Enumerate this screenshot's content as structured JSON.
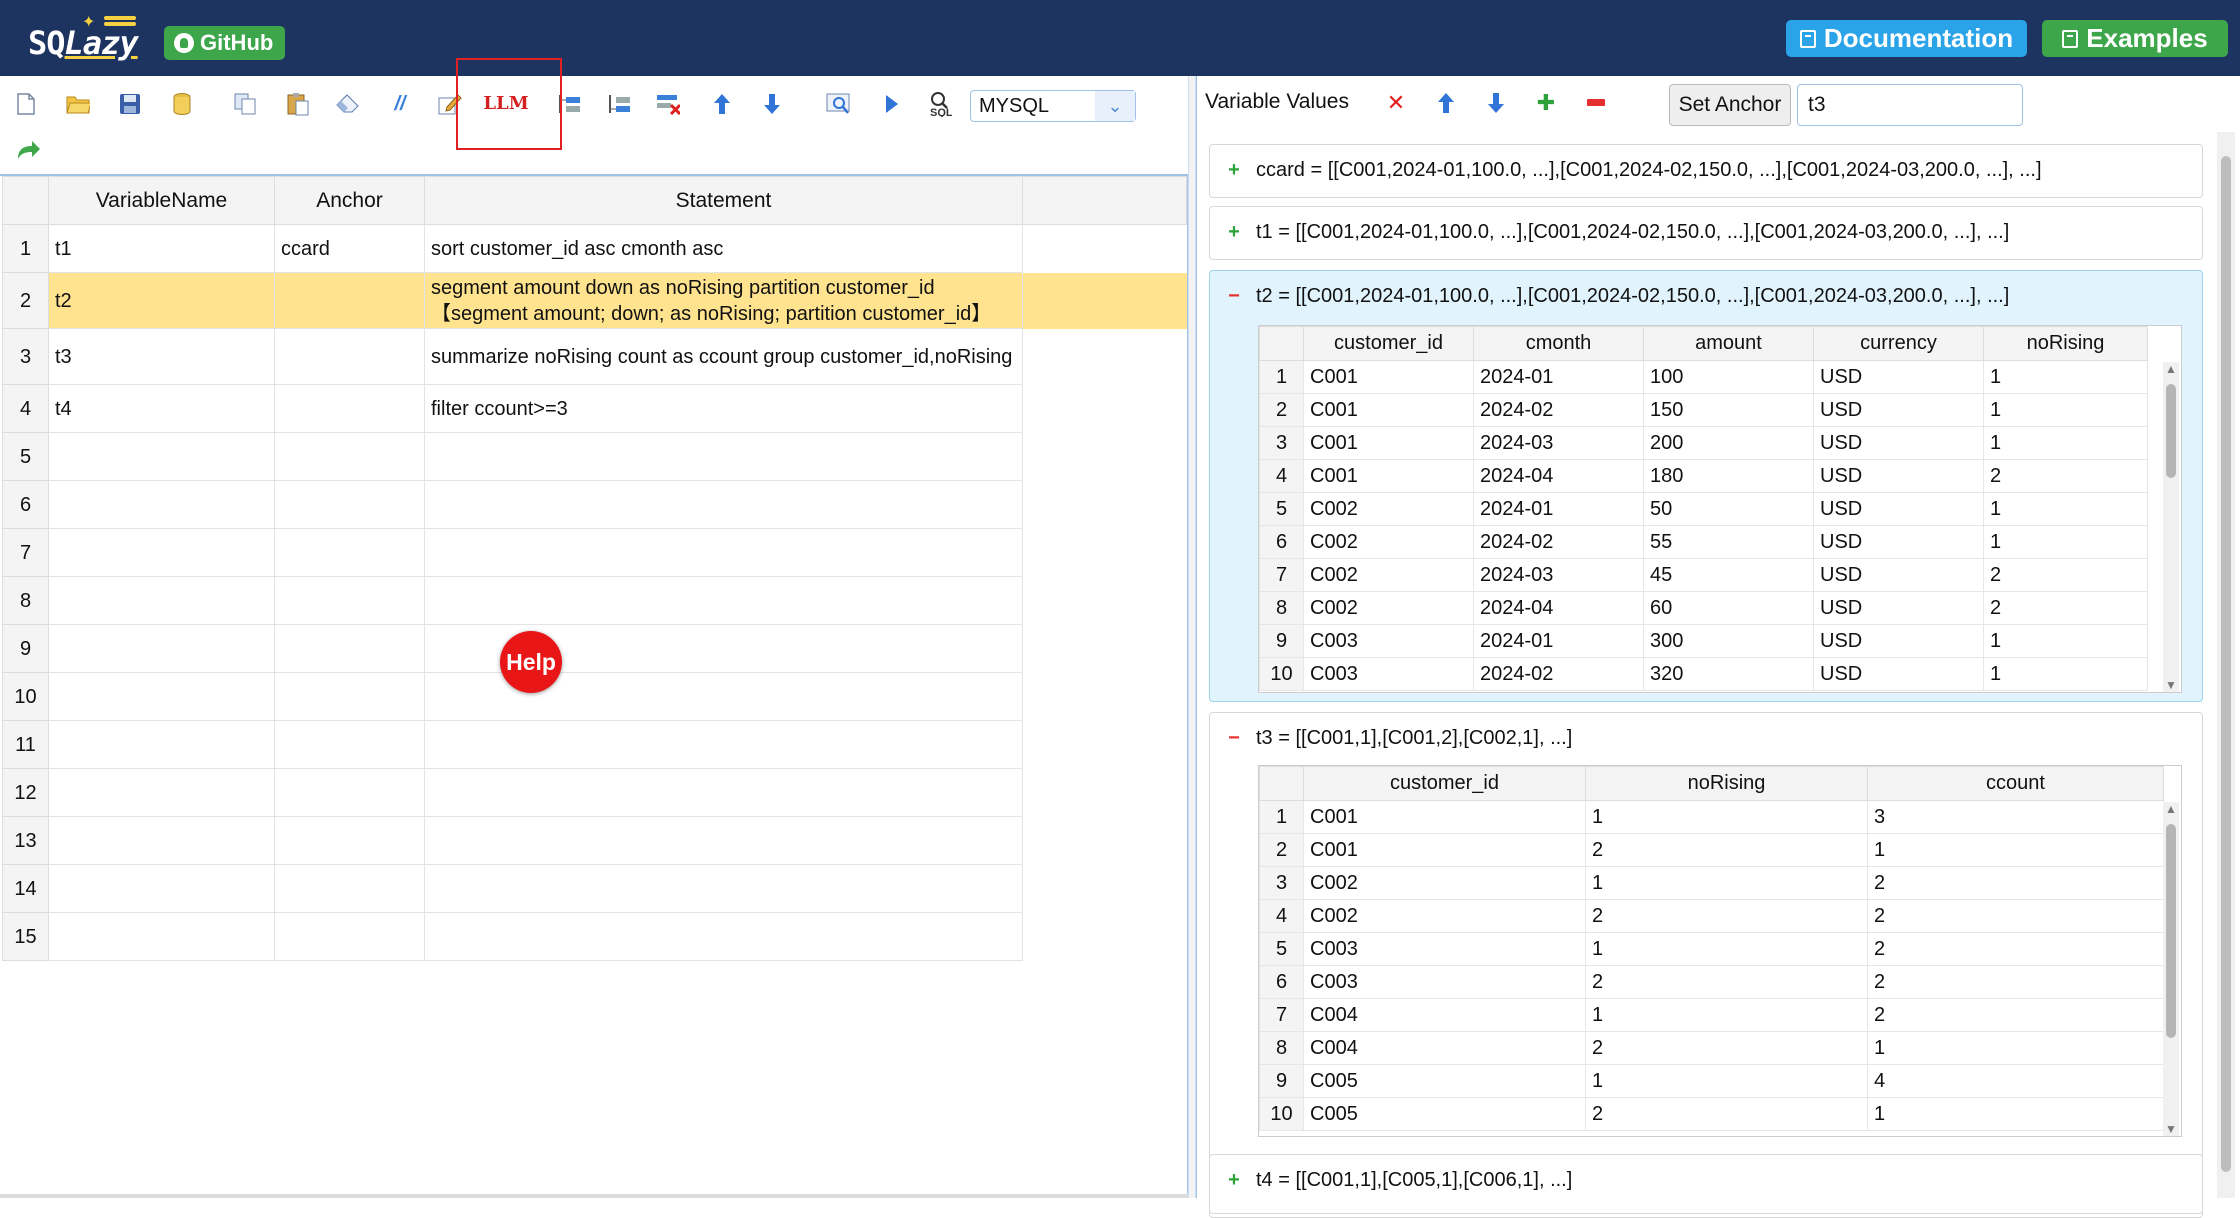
{
  "header": {
    "logo_text_a": "SQ",
    "logo_text_b": "Lazy",
    "github_label": "GitHub",
    "documentation_label": "Documentation",
    "examples_label": "Examples"
  },
  "toolbar": {
    "llm_label": "LLM",
    "db_select_value": "MYSQL",
    "icons": [
      "new-file-icon",
      "open-folder-icon",
      "save-icon",
      "database-icon",
      "copy-icon",
      "paste-icon",
      "eraser-icon",
      "comment-icon",
      "edit-icon",
      "llm-icon",
      "insert-row-above-icon",
      "insert-row-below-icon",
      "delete-row-icon",
      "move-up-icon",
      "move-down-icon",
      "preview-icon",
      "run-icon",
      "sql-icon",
      "redo-icon"
    ]
  },
  "grid": {
    "columns": [
      "VariableName",
      "Anchor",
      "Statement"
    ],
    "rows": [
      {
        "num": "1",
        "name": "t1",
        "anchor": "ccard",
        "statement": "sort customer_id asc cmonth asc"
      },
      {
        "num": "2",
        "name": "t2",
        "anchor": "",
        "statement": "segment amount down as noRising partition customer_id 【segment amount; down; as noRising; partition customer_id】"
      },
      {
        "num": "3",
        "name": "t3",
        "anchor": "",
        "statement": "summarize noRising count as ccount group customer_id,noRising"
      },
      {
        "num": "4",
        "name": "t4",
        "anchor": "",
        "statement": "filter ccount>=3"
      },
      {
        "num": "5",
        "name": "",
        "anchor": "",
        "statement": ""
      },
      {
        "num": "6",
        "name": "",
        "anchor": "",
        "statement": ""
      },
      {
        "num": "7",
        "name": "",
        "anchor": "",
        "statement": ""
      },
      {
        "num": "8",
        "name": "",
        "anchor": "",
        "statement": ""
      },
      {
        "num": "9",
        "name": "",
        "anchor": "",
        "statement": ""
      },
      {
        "num": "10",
        "name": "",
        "anchor": "",
        "statement": ""
      },
      {
        "num": "11",
        "name": "",
        "anchor": "",
        "statement": ""
      },
      {
        "num": "12",
        "name": "",
        "anchor": "",
        "statement": ""
      },
      {
        "num": "13",
        "name": "",
        "anchor": "",
        "statement": ""
      },
      {
        "num": "14",
        "name": "",
        "anchor": "",
        "statement": ""
      },
      {
        "num": "15",
        "name": "",
        "anchor": "",
        "statement": ""
      }
    ],
    "selected_row": 2
  },
  "help_label": "Help",
  "right": {
    "title": "Variable Values",
    "set_anchor_label": "Set Anchor",
    "anchor_value": "t3",
    "panels": [
      {
        "label": "ccard = [[C001,2024-01,100.0, ...],[C001,2024-02,150.0, ...],[C001,2024-03,200.0, ...], ...]",
        "expanded": false
      },
      {
        "label": "t1 = [[C001,2024-01,100.0, ...],[C001,2024-02,150.0, ...],[C001,2024-03,200.0, ...], ...]",
        "expanded": false
      },
      {
        "label": "t2 = [[C001,2024-01,100.0, ...],[C001,2024-02,150.0, ...],[C001,2024-03,200.0, ...], ...]",
        "expanded": true
      },
      {
        "label": "t3 = [[C001,1],[C001,2],[C002,1], ...]",
        "expanded": true
      },
      {
        "label": "t4 = [[C001,1],[C005,1],[C006,1], ...]",
        "expanded": false
      }
    ],
    "t2_table": {
      "columns": [
        "customer_id",
        "cmonth",
        "amount",
        "currency",
        "noRising"
      ],
      "rows": [
        [
          "1",
          "C001",
          "2024-01",
          "100",
          "USD",
          "1"
        ],
        [
          "2",
          "C001",
          "2024-02",
          "150",
          "USD",
          "1"
        ],
        [
          "3",
          "C001",
          "2024-03",
          "200",
          "USD",
          "1"
        ],
        [
          "4",
          "C001",
          "2024-04",
          "180",
          "USD",
          "2"
        ],
        [
          "5",
          "C002",
          "2024-01",
          "50",
          "USD",
          "1"
        ],
        [
          "6",
          "C002",
          "2024-02",
          "55",
          "USD",
          "1"
        ],
        [
          "7",
          "C002",
          "2024-03",
          "45",
          "USD",
          "2"
        ],
        [
          "8",
          "C002",
          "2024-04",
          "60",
          "USD",
          "2"
        ],
        [
          "9",
          "C003",
          "2024-01",
          "300",
          "USD",
          "1"
        ],
        [
          "10",
          "C003",
          "2024-02",
          "320",
          "USD",
          "1"
        ]
      ]
    },
    "t3_table": {
      "columns": [
        "customer_id",
        "noRising",
        "ccount"
      ],
      "rows": [
        [
          "1",
          "C001",
          "1",
          "3"
        ],
        [
          "2",
          "C001",
          "2",
          "1"
        ],
        [
          "3",
          "C002",
          "1",
          "2"
        ],
        [
          "4",
          "C002",
          "2",
          "2"
        ],
        [
          "5",
          "C003",
          "1",
          "2"
        ],
        [
          "6",
          "C003",
          "2",
          "2"
        ],
        [
          "7",
          "C004",
          "1",
          "2"
        ],
        [
          "8",
          "C004",
          "2",
          "1"
        ],
        [
          "9",
          "C005",
          "1",
          "4"
        ],
        [
          "10",
          "C005",
          "2",
          "1"
        ]
      ]
    }
  }
}
